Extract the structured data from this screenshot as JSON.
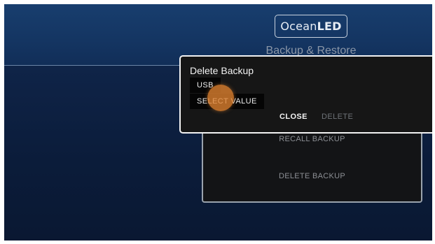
{
  "header": {
    "logo": {
      "prefix": "Ocean",
      "suffix": "LED"
    },
    "title": "Backup & Restore"
  },
  "menu": {
    "items": [
      {
        "label": "RECALL BACKUP"
      },
      {
        "label": "DELETE BACKUP"
      }
    ]
  },
  "dialog": {
    "title": "Delete Backup",
    "source_value": "USB",
    "select_label": "SELECT VALUE",
    "close_label": "CLOSE",
    "delete_label": "DELETE"
  },
  "colors": {
    "header_blue": "#143562",
    "background_navy": "#0c1d3a",
    "dialog_bg": "#161616",
    "dialog_border": "#f2f2f2",
    "touch_indicator": "#e28330"
  }
}
